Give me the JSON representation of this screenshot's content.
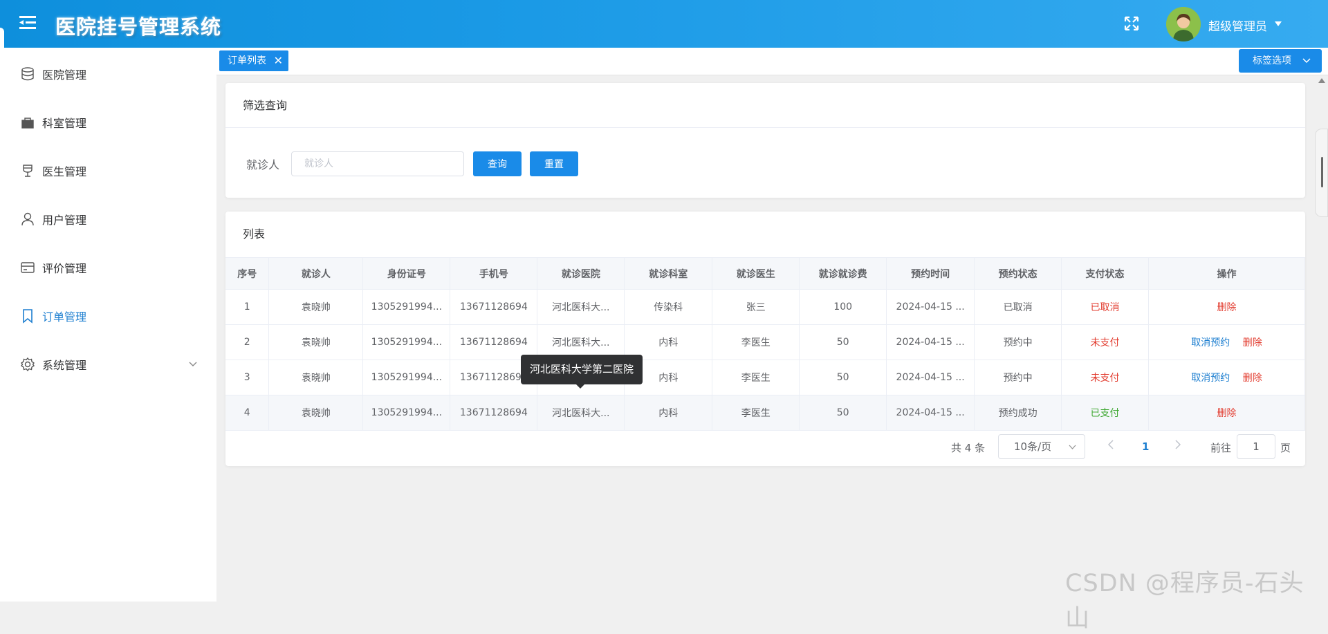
{
  "header": {
    "title": "医院挂号管理系统",
    "user_name": "超级管理员",
    "bg_color": "#1b9ae6"
  },
  "sidebar": {
    "items": [
      {
        "label": "医院管理",
        "icon": "database-icon"
      },
      {
        "label": "科室管理",
        "icon": "bag-icon"
      },
      {
        "label": "医生管理",
        "icon": "goblet-icon"
      },
      {
        "label": "用户管理",
        "icon": "user-icon"
      },
      {
        "label": "评价管理",
        "icon": "card-icon"
      },
      {
        "label": "订单管理",
        "icon": "bookmark-icon",
        "active": true
      },
      {
        "label": "系统管理",
        "icon": "gear-icon"
      }
    ],
    "active_color": "#1e7fd0"
  },
  "tabs": {
    "active_tab": "订单列表",
    "close_glyph": "✕",
    "options_label": "标签选项"
  },
  "filter": {
    "title": "筛选查询",
    "label": "就诊人",
    "placeholder": "就诊人",
    "query_label": "查询",
    "reset_label": "重置"
  },
  "list": {
    "title": "列表",
    "columns": [
      "序号",
      "就诊人",
      "身份证号",
      "手机号",
      "就诊医院",
      "就诊科室",
      "就诊医生",
      "就诊就诊费",
      "预约时间",
      "预约状态",
      "支付状态",
      "操作"
    ],
    "rows": [
      {
        "no": "1",
        "patient": "袁晓帅",
        "id_card": "1305291994...",
        "phone": "13671128694",
        "hospital": "河北医科大...",
        "dept": "传染科",
        "doctor": "张三",
        "fee": "100",
        "time": "2024-04-15 ...",
        "status": "已取消",
        "pay": "已取消",
        "cancel": "",
        "delete": "删除"
      },
      {
        "no": "2",
        "patient": "袁晓帅",
        "id_card": "1305291994...",
        "phone": "13671128694",
        "hospital": "河北医科大...",
        "dept": "内科",
        "doctor": "李医生",
        "fee": "50",
        "time": "2024-04-15 ...",
        "status": "预约中",
        "pay": "未支付",
        "cancel": "取消预约",
        "delete": "删除"
      },
      {
        "no": "3",
        "patient": "袁晓帅",
        "id_card": "1305291994...",
        "phone": "13671128694",
        "hospital": "",
        "dept": "内科",
        "doctor": "李医生",
        "fee": "50",
        "time": "2024-04-15 ...",
        "status": "预约中",
        "pay": "未支付",
        "cancel": "取消预约",
        "delete": "删除"
      },
      {
        "no": "4",
        "patient": "袁晓帅",
        "id_card": "1305291994...",
        "phone": "13671128694",
        "hospital": "河北医科大...",
        "dept": "内科",
        "doctor": "李医生",
        "fee": "50",
        "time": "2024-04-15 ...",
        "status": "预约成功",
        "pay": "已支付",
        "cancel": "",
        "delete": "删除"
      }
    ],
    "tooltip": "河北医科大学第二医院"
  },
  "pager": {
    "total": "共 4 条",
    "page_size": "10条/页",
    "current": "1",
    "goto_label": "前往",
    "goto_value": "1",
    "page_suffix": "页"
  },
  "watermark": "CSDN @程序员-石头山"
}
